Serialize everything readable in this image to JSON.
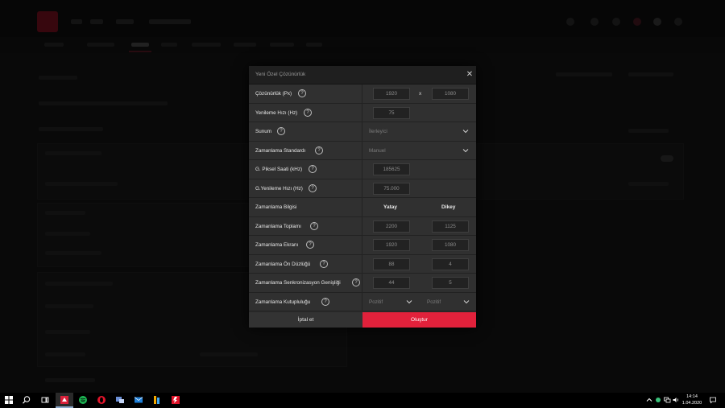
{
  "dialog": {
    "title": "Yeni Özel Çözünürlük",
    "rows": {
      "resolution": {
        "label": "Çözünürlük (Px)",
        "width": "1920",
        "separator": "x",
        "height": "1080"
      },
      "refresh_rate": {
        "label": "Yenileme Hızı (Hz)",
        "value": "75"
      },
      "presentation": {
        "label": "Sunum",
        "value": "İlerleyici"
      },
      "timing_standard": {
        "label": "Zamanlama Standardı",
        "value": "Manuel"
      },
      "pixel_clock": {
        "label": "G. Piksel Saati (kHz)",
        "value": "185625"
      },
      "g_refresh_rate": {
        "label": "G.Yenileme Hızı (Hz)",
        "value": "75.000"
      },
      "timing_info": {
        "label": "Zamanlama Bilgisi",
        "col_horizontal": "Yatay",
        "col_vertical": "Dikey"
      },
      "timing_total": {
        "label": "Zamanlama Toplamı",
        "horizontal": "2200",
        "vertical": "1125"
      },
      "timing_screen": {
        "label": "Zamanlama Ekranı",
        "horizontal": "1920",
        "vertical": "1080"
      },
      "timing_front_porch": {
        "label": "Zamanlama Ön Düzlüğü",
        "horizontal": "88",
        "vertical": "4"
      },
      "timing_sync_width": {
        "label": "Zamanlama Senkronizasyon Genişliği",
        "horizontal": "44",
        "vertical": "5"
      },
      "timing_polarity": {
        "label": "Zamanlama Kutupluluğu",
        "horizontal": "Pozitif",
        "vertical": "Pozitif"
      }
    },
    "cancel_label": "İptal et",
    "create_label": "Oluştur"
  },
  "taskbar": {
    "time": "14:14",
    "date": "1.04.2020"
  },
  "colors": {
    "accent": "#e1213b",
    "dialog_bg": "#2a2a2a",
    "row_bg": "#303030"
  }
}
